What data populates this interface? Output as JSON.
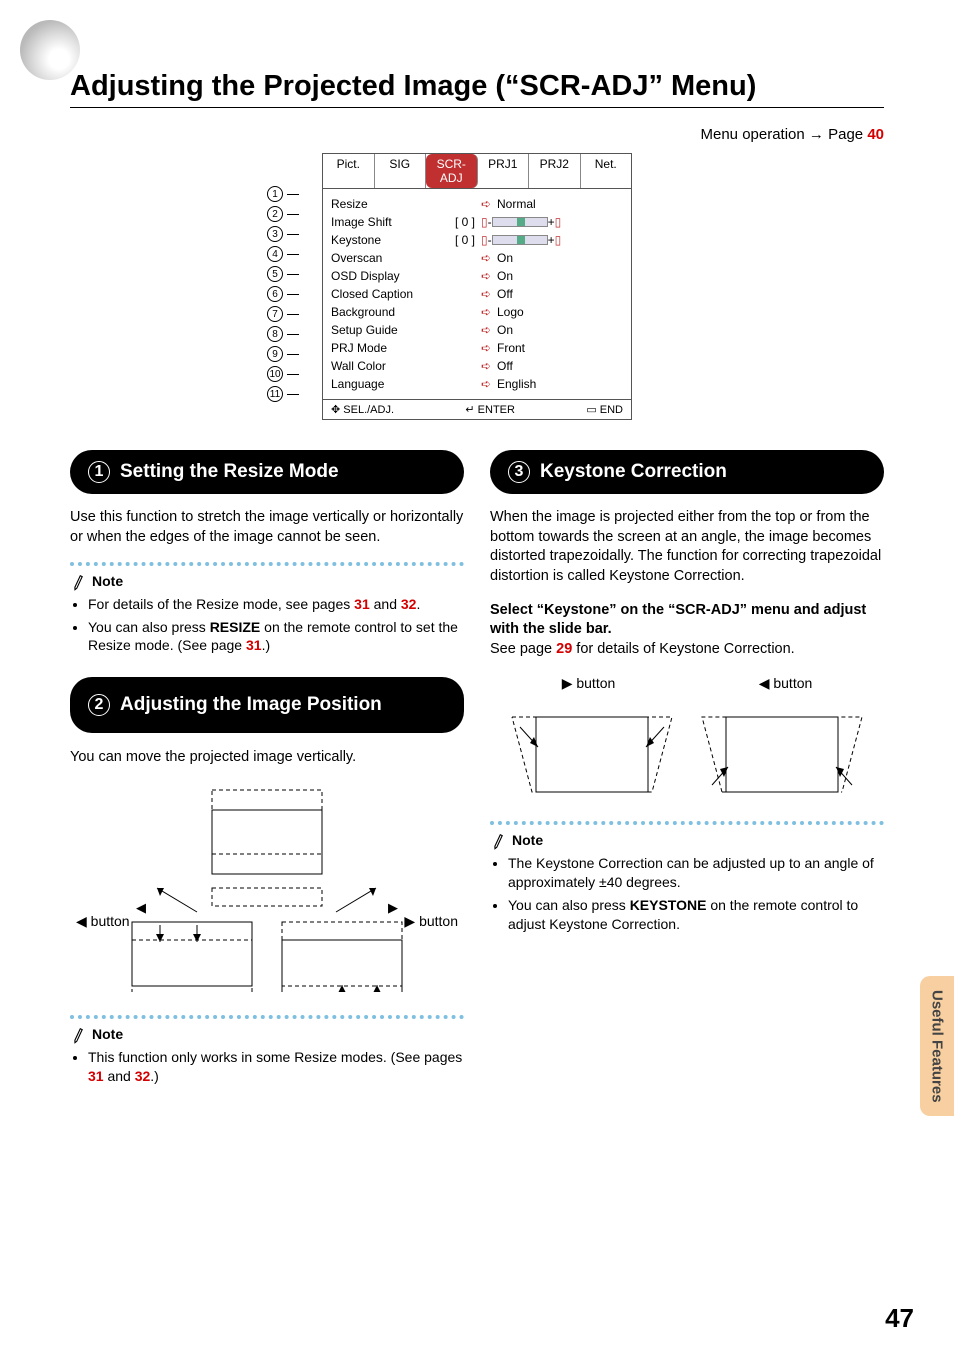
{
  "title": "Adjusting the Projected Image (“SCR-ADJ” Menu)",
  "menu_operation": {
    "label": "Menu operation",
    "arrow": "→",
    "page_word": "Page",
    "page": "40"
  },
  "osd": {
    "tabs": [
      "Pict.",
      "SIG",
      "SCR-ADJ",
      "PRJ1",
      "PRJ2",
      "Net."
    ],
    "items": [
      {
        "n": "1",
        "name": "Resize",
        "type": "arrow",
        "value": "Normal"
      },
      {
        "n": "2",
        "name": "Image Shift",
        "type": "slider",
        "mid": "[     0 ]"
      },
      {
        "n": "3",
        "name": "Keystone",
        "type": "slider",
        "mid": "[     0 ]"
      },
      {
        "n": "4",
        "name": "Overscan",
        "type": "arrow",
        "value": "On"
      },
      {
        "n": "5",
        "name": "OSD Display",
        "type": "arrow",
        "value": "On"
      },
      {
        "n": "6",
        "name": "Closed Caption",
        "type": "arrow",
        "value": "Off"
      },
      {
        "n": "7",
        "name": "Background",
        "type": "arrow",
        "value": "Logo"
      },
      {
        "n": "8",
        "name": "Setup Guide",
        "type": "arrow",
        "value": "On"
      },
      {
        "n": "9",
        "name": "PRJ Mode",
        "type": "arrow",
        "value": "Front"
      },
      {
        "n": "10",
        "name": "Wall Color",
        "type": "arrow",
        "value": "Off"
      },
      {
        "n": "11",
        "name": "Language",
        "type": "arrow",
        "value": "English"
      }
    ],
    "footer": {
      "sel": "SEL./ADJ.",
      "enter": "ENTER",
      "end": "END"
    }
  },
  "s1": {
    "num": "1",
    "title": "Setting the Resize Mode",
    "body": "Use this function to stretch the image vertically or horizontally or when the edges of the image cannot be seen.",
    "note_label": "Note",
    "notes": [
      {
        "pre": "For details of the Resize mode, see pages ",
        "l1": "31",
        "mid": " and ",
        "l2": "32",
        "post": "."
      },
      {
        "pre": "You can also press ",
        "b": "RESIZE",
        "mid": " on the remote control to set the Resize mode. (See page ",
        "l1": "31",
        "post": ".)"
      }
    ]
  },
  "s2": {
    "num": "2",
    "title": "Adjusting the Image Position",
    "body": "You can move the projected image vertically.",
    "btn_left": "button",
    "btn_right": "button",
    "note_label": "Note",
    "notes": [
      {
        "pre": "This function only works in some Resize modes. (See pages ",
        "l1": "31",
        "mid": " and ",
        "l2": "32",
        "post": ".)"
      }
    ]
  },
  "s3": {
    "num": "3",
    "title": "Keystone Correction",
    "body": "When the image is projected either from the top or from the bottom towards the screen at an angle, the image becomes distorted trapezoidally. The function for correcting trapezoidal distortion is called Keystone Correction.",
    "instruct_b": "Select “Keystone” on the “SCR-ADJ” menu and adjust with the slide bar.",
    "instruct_post_pre": "See page ",
    "instruct_link": "29",
    "instruct_post": " for details of Keystone Correction.",
    "btn_left": "button",
    "btn_right": "button",
    "note_label": "Note",
    "notes": [
      {
        "text": "The Keystone Correction can be adjusted up to an angle of approximately ±40 degrees."
      },
      {
        "pre": "You can also press ",
        "b": "KEYSTONE",
        "post": " on the remote control to adjust Keystone Correction."
      }
    ]
  },
  "side_tab": "Useful Features",
  "page_number": "47"
}
